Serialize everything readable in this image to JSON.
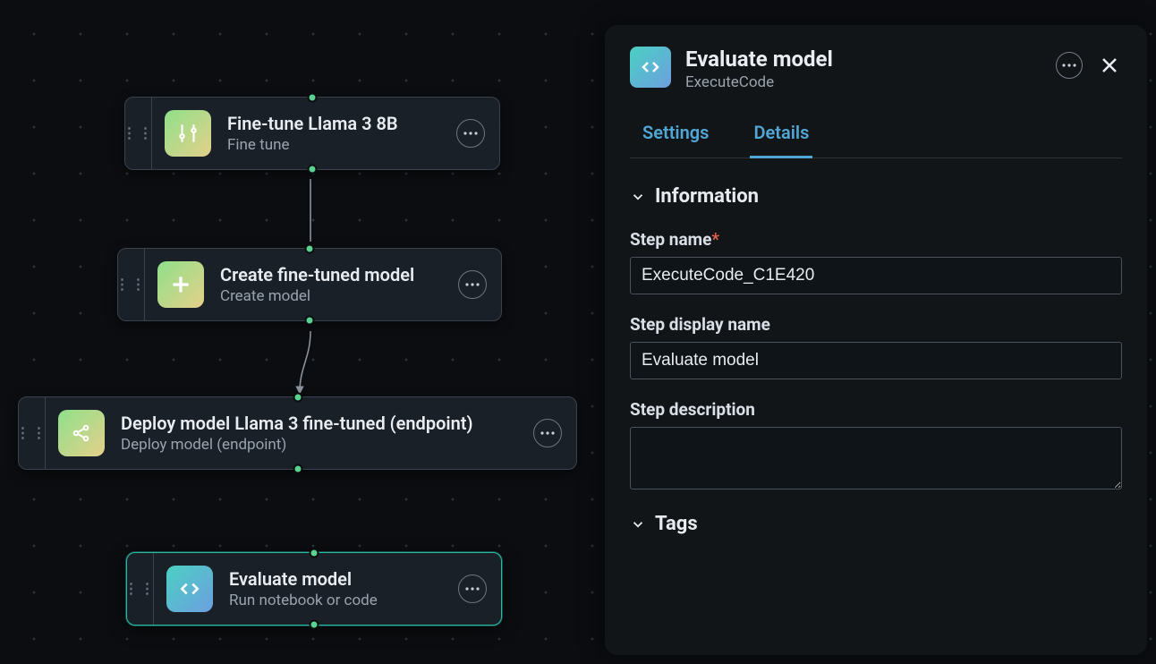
{
  "nodes": {
    "n1": {
      "title": "Fine-tune Llama 3 8B",
      "subtitle": "Fine tune"
    },
    "n2": {
      "title": "Create fine-tuned model",
      "subtitle": "Create model"
    },
    "n3": {
      "title": "Deploy model Llama 3 fine-tuned (endpoint)",
      "subtitle": "Deploy model (endpoint)"
    },
    "n4": {
      "title": "Evaluate model",
      "subtitle": "Run notebook or code"
    }
  },
  "panel": {
    "title": "Evaluate model",
    "subtitle": "ExecuteCode",
    "tabs": {
      "settings": "Settings",
      "details": "Details"
    },
    "sections": {
      "info": "Information",
      "tags": "Tags"
    },
    "form": {
      "step_name_label": "Step name",
      "step_name_value": "ExecuteCode_C1E420",
      "display_name_label": "Step display name",
      "display_name_value": "Evaluate model",
      "description_label": "Step description",
      "description_value": ""
    }
  }
}
